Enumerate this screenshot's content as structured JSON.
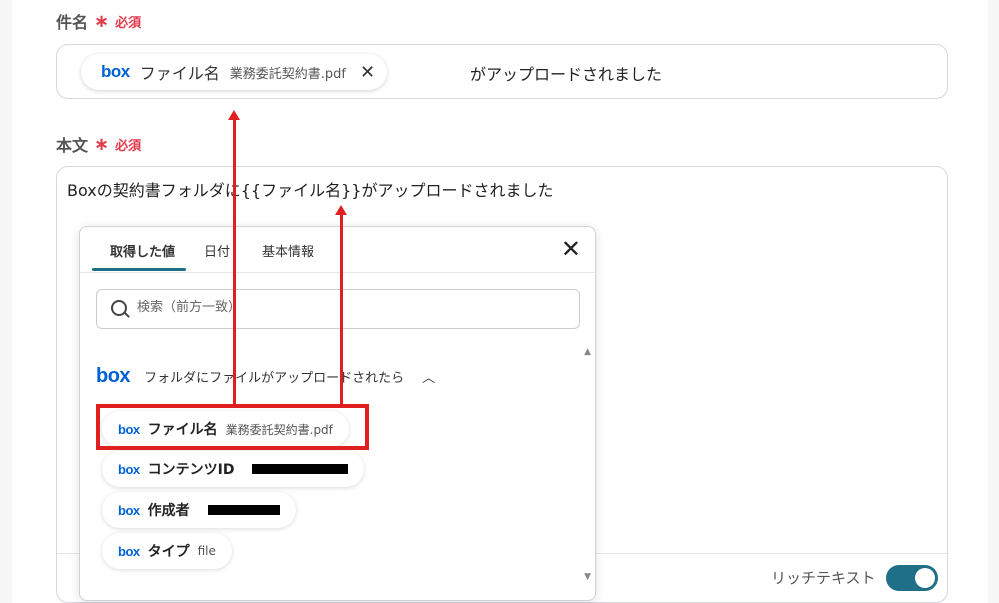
{
  "subject": {
    "label": "件名",
    "required_mark": "∗",
    "required_text": "必須",
    "token": {
      "icon": "box",
      "label": "ファイル名",
      "value": "業務委託契約書.pdf",
      "close": "✕"
    },
    "suffix": "がアップロードされました"
  },
  "body": {
    "label": "本文",
    "required_mark": "∗",
    "required_text": "必須",
    "text": "Boxの契約書フォルダに{{ファイル名}}がアップロードされました",
    "rich_text_label": "リッチテキスト",
    "rich_text_enabled": true
  },
  "popover": {
    "tabs": [
      {
        "label": "取得した値",
        "active": true
      },
      {
        "label": "日付",
        "active": false
      },
      {
        "label": "基本情報",
        "active": false
      }
    ],
    "close": "✕",
    "search_placeholder": "検索（前方一致）",
    "group": {
      "icon": "box",
      "title": "フォルダにファイルがアップロードされたら",
      "chevron": "︿"
    },
    "items": [
      {
        "icon": "box",
        "label": "ファイル名",
        "value": "業務委託契約書.pdf",
        "redacted": false
      },
      {
        "icon": "box",
        "label": "コンテンツID",
        "value": "",
        "redacted": true
      },
      {
        "icon": "box",
        "label": "作成者",
        "value": "",
        "redacted": true
      },
      {
        "icon": "box",
        "label": "タイプ",
        "value": "file",
        "redacted": false
      }
    ]
  },
  "colors": {
    "accent": "#1f6f87",
    "required": "#e23b4b",
    "annotation": "#e02020",
    "box_brand": "#0061d5"
  }
}
